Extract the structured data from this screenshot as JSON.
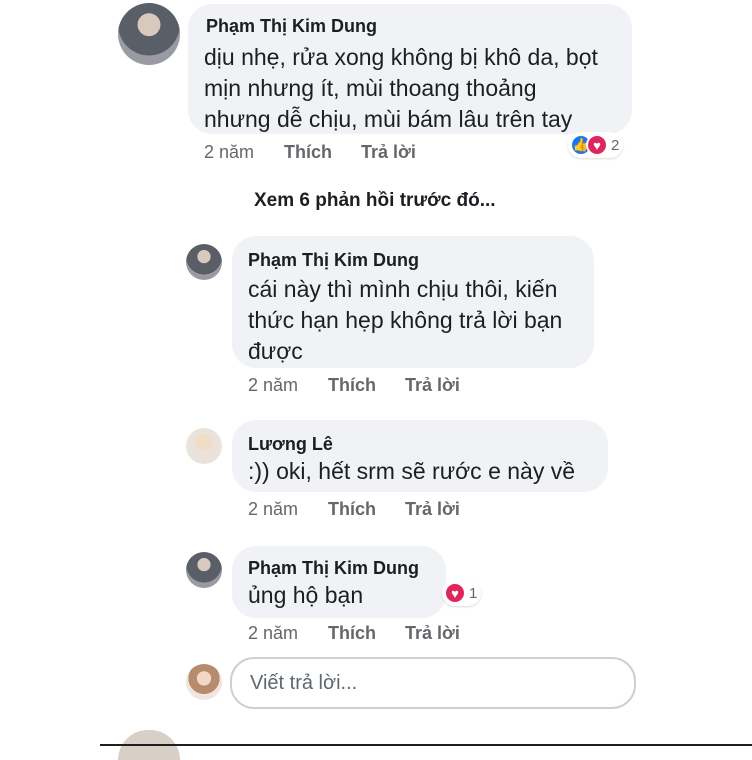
{
  "comments": [
    {
      "author": "Phạm Thị Kim Dung",
      "text": "dịu nhẹ, rửa xong không bị khô da, bọt\nmịn nhưng ít, mùi thoang thoảng\nnhưng dễ chịu, mùi bám lâu trên tay",
      "time": "2 năm",
      "like_label": "Thích",
      "reply_label": "Trả lời",
      "reaction_count": "2"
    }
  ],
  "view_more_label": "Xem 6 phản hồi trước đó...",
  "replies": [
    {
      "author": "Phạm Thị Kim Dung",
      "text": "cái này thì mình chịu thôi, kiến\nthức hạn hẹp không trả lời bạn\nđược",
      "time": "2 năm",
      "like_label": "Thích",
      "reply_label": "Trả lời"
    },
    {
      "author": "Lương Lê",
      "text": ":)) oki,  hết srm sẽ rước e này về",
      "time": "2 năm",
      "like_label": "Thích",
      "reply_label": "Trả lời"
    },
    {
      "author": "Phạm Thị Kim Dung",
      "text": "ủng hộ bạn",
      "time": "2 năm",
      "like_label": "Thích",
      "reply_label": "Trả lời",
      "reaction_count": "1"
    }
  ],
  "reply_input": {
    "placeholder": "Viết trả lời..."
  },
  "colors": {
    "bubble": "#f0f2f5",
    "like_blue": "#1877f2",
    "love_red": "#e0245e"
  }
}
